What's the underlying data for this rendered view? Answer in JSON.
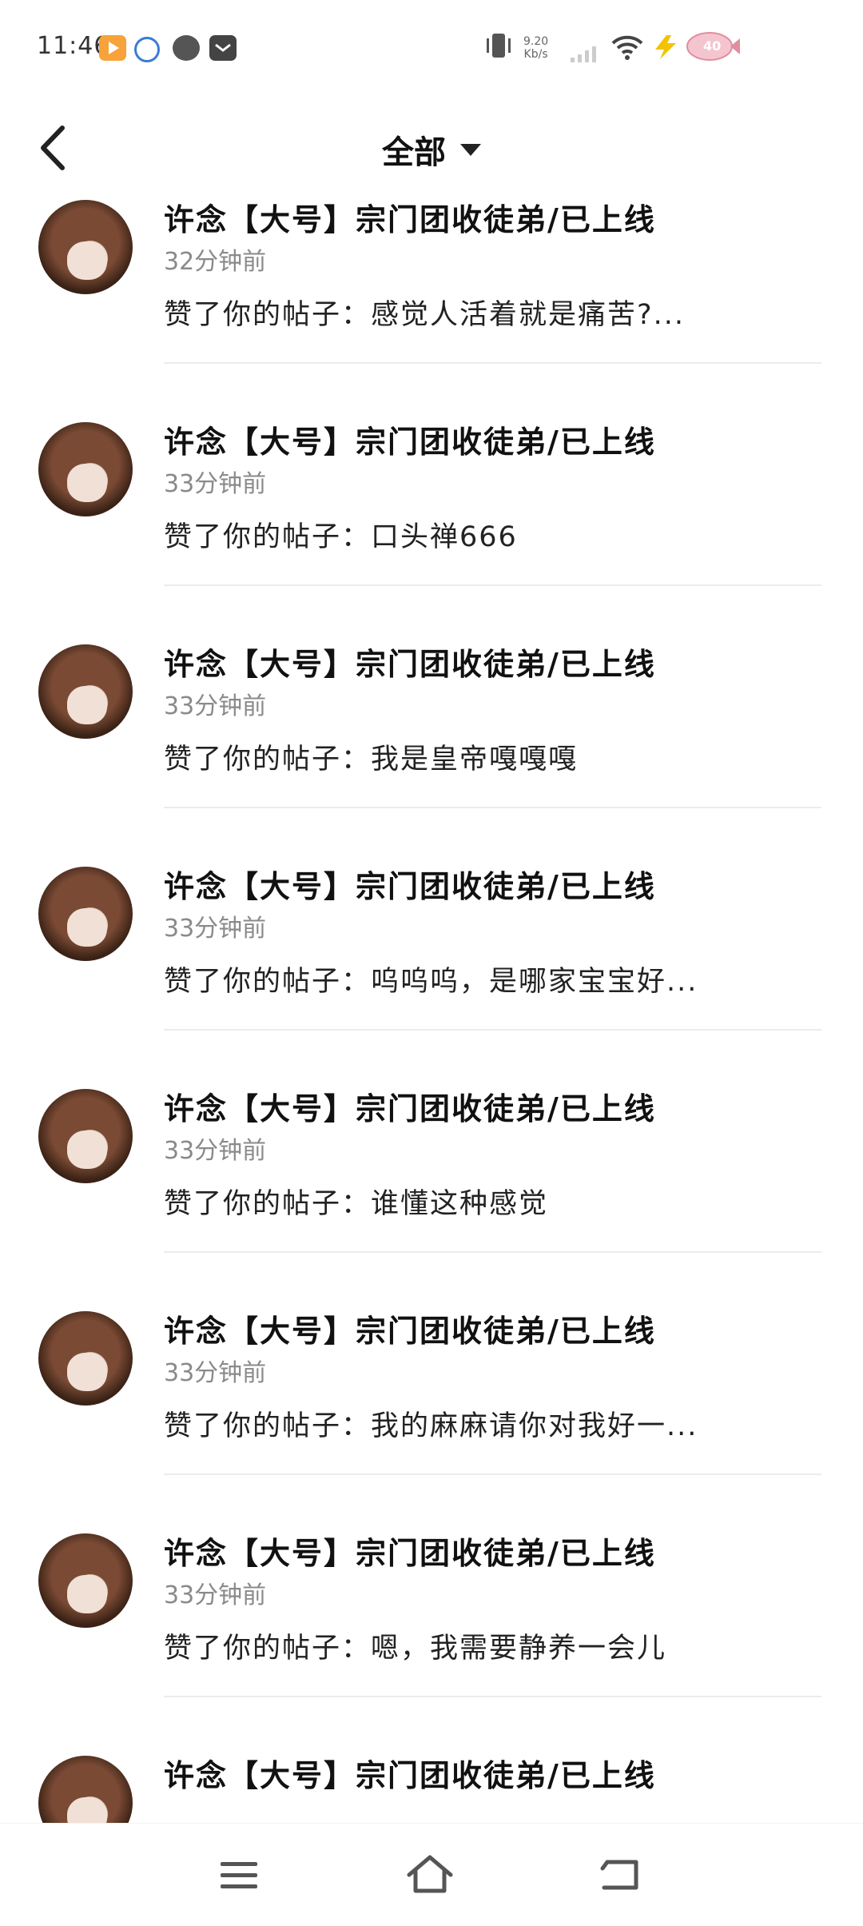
{
  "status_bar": {
    "time": "11:46",
    "network_speed_value": "9.20",
    "network_speed_unit": "Kb/s",
    "battery_level": "40"
  },
  "header": {
    "title": "全部"
  },
  "notifications": [
    {
      "name": "许念【大号】宗门团收徒弟/已上线",
      "time": "32分钟前",
      "message": "赞了你的帖子：感觉人活着就是痛苦?..."
    },
    {
      "name": "许念【大号】宗门团收徒弟/已上线",
      "time": "33分钟前",
      "message": "赞了你的帖子：口头禅666"
    },
    {
      "name": "许念【大号】宗门团收徒弟/已上线",
      "time": "33分钟前",
      "message": "赞了你的帖子：我是皇帝嘎嘎嘎"
    },
    {
      "name": "许念【大号】宗门团收徒弟/已上线",
      "time": "33分钟前",
      "message": "赞了你的帖子：呜呜呜，是哪家宝宝好..."
    },
    {
      "name": "许念【大号】宗门团收徒弟/已上线",
      "time": "33分钟前",
      "message": "赞了你的帖子：谁懂这种感觉"
    },
    {
      "name": "许念【大号】宗门团收徒弟/已上线",
      "time": "33分钟前",
      "message": "赞了你的帖子：我的麻麻请你对我好一..."
    },
    {
      "name": "许念【大号】宗门团收徒弟/已上线",
      "time": "33分钟前",
      "message": "赞了你的帖子：嗯，我需要静养一会儿"
    },
    {
      "name": "许念【大号】宗门团收徒弟/已上线",
      "time": "",
      "message": ""
    }
  ],
  "colors": {
    "background": "#ffffff",
    "text": "#111111",
    "secondary": "#8a8a8a",
    "divider": "#ececec"
  },
  "icons": [
    "back-arrow-icon",
    "dropdown-caret-icon",
    "menu-icon",
    "home-icon",
    "back-nav-icon"
  ]
}
